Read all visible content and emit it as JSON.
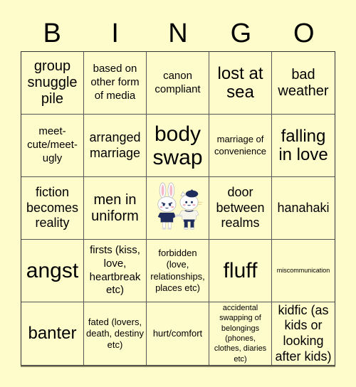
{
  "header": {
    "letters": [
      "B",
      "I",
      "N",
      "G",
      "O"
    ]
  },
  "cells": [
    "group snuggle pile",
    "based on other form of media",
    "canon compliant",
    "lost at sea",
    "bad weather",
    "meet-cute/meet-ugly",
    "arranged marriage",
    "body swap",
    "marriage of convenience",
    "falling in love",
    "fiction becomes reality",
    "men in uniform",
    "",
    "door between realms",
    "hanahaki",
    "angst",
    "firsts (kiss, love, heartbreak etc)",
    "forbidden (love, relationships, places etc)",
    "fluff",
    "miscommunication",
    "banter",
    "fated (lovers, death, destiny etc)",
    "hurt/comfort",
    "accidental swapping of belongings (phones, clothes, diaries etc)",
    "kidfic (as kids or looking after kids)"
  ],
  "free_space": {
    "icon": "bunny-and-cat-characters-icon"
  },
  "colors": {
    "background": "#fffccc",
    "grid_line": "#555555",
    "text": "#000000"
  }
}
